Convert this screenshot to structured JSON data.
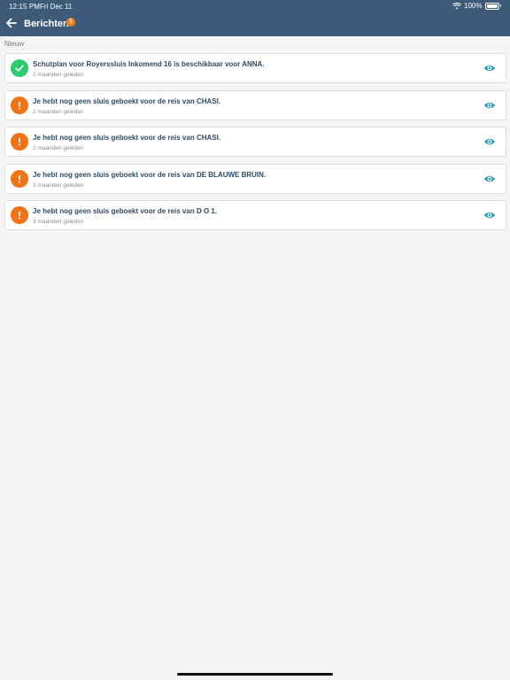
{
  "status_bar": {
    "time": "12:15 PM",
    "date": "Fri Dec 11",
    "battery": "100%"
  },
  "header": {
    "title": "Berichten",
    "badge_count": "5"
  },
  "section": {
    "label": "Nieuw"
  },
  "messages": [
    {
      "status": "success",
      "status_icon": "check-icon",
      "title": "Schutplan voor Royerssluis Inkomend 16 is beschikbaar voor ANNA.",
      "time": "2 maanden geleden"
    },
    {
      "status": "warning",
      "status_icon": "exclamation-icon",
      "title": "Je hebt nog geen sluis geboekt voor de reis van CHASI.",
      "time": "2 maanden geleden"
    },
    {
      "status": "warning",
      "status_icon": "exclamation-icon",
      "title": "Je hebt nog geen sluis geboekt voor de reis van CHASI.",
      "time": "2 maanden geleden"
    },
    {
      "status": "warning",
      "status_icon": "exclamation-icon",
      "title": "Je hebt nog geen sluis geboekt voor de reis van DE BLAUWE BRUIN.",
      "time": "3 maanden geleden"
    },
    {
      "status": "warning",
      "status_icon": "exclamation-icon",
      "title": "Je hebt nog geen sluis geboekt voor de reis van D O 1.",
      "time": "3 maanden geleden"
    }
  ],
  "colors": {
    "header_bg": "#3d5a78",
    "success": "#2ecc71",
    "warning": "#f47216",
    "badge": "#f07c1b",
    "eye": "#2a9bb5",
    "title_text": "#2d4a64"
  }
}
